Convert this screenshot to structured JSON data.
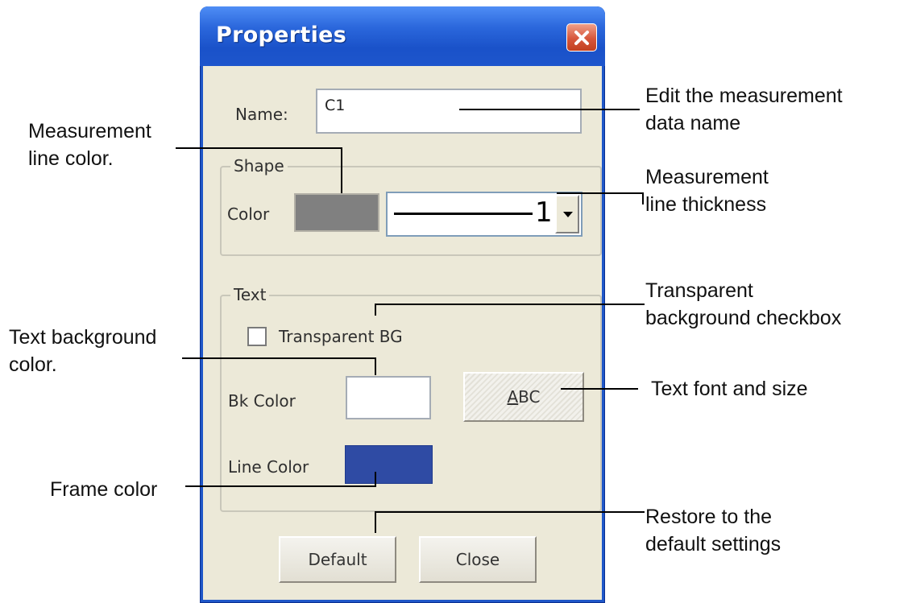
{
  "dialog": {
    "title": "Properties",
    "close_icon": "close-icon",
    "name_label": "Name:",
    "name_value": "C1",
    "shape": {
      "legend": "Shape",
      "color_label": "Color",
      "color_value": "#808080",
      "thickness_value": "1",
      "dropdown_icon": "chevron-down-icon"
    },
    "text": {
      "legend": "Text",
      "transparent_bg_label": "Transparent BG",
      "transparent_bg_checked": false,
      "bk_color_label": "Bk Color",
      "bk_color_value": "#ffffff",
      "font_button_underlined": "A",
      "font_button_rest": "BC",
      "line_color_label": "Line Color",
      "line_color_value": "#2f4ba4"
    },
    "buttons": {
      "default_label": "Default",
      "close_label": "Close"
    }
  },
  "annotations": {
    "name": "Edit the measurement\ndata name",
    "shape_color": "Measurement\nline color.",
    "thickness": "Measurement\nline thickness",
    "transparent": "Transparent\nbackground checkbox",
    "bk_color": "Text background\ncolor.",
    "font": "Text font and size",
    "frame_color": "Frame color",
    "default": "Restore to the\ndefault settings"
  },
  "colors": {
    "title_bar": "#2b67dc",
    "client_bg": "#ece9d8",
    "close_button": "#d7563b"
  }
}
